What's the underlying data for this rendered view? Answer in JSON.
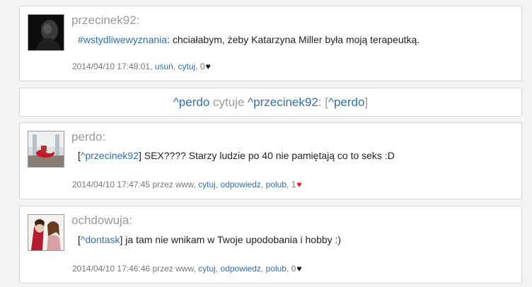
{
  "posts": [
    {
      "author": "przecinek92:",
      "hashtag": "#wstydliwewyznania",
      "text": ": chciałabym, żeby Katarzyna Miller była moją terapeutką.",
      "timestamp": "2014/04/10 17:48:01,",
      "actions": [
        "usuń",
        "cytuj"
      ],
      "likes": "0",
      "heart": "black"
    },
    {
      "author": "perdo:",
      "reply_to": "^przecinek92",
      "text": " SEX???? Starzy ludzie po 40 nie pamiętają co to seks :D",
      "timestamp": "2014/04/10 17:47:45",
      "via": "przez www,",
      "actions": [
        "cytuj",
        "odpowiedz",
        "polub"
      ],
      "likes": "1",
      "heart": "red"
    },
    {
      "author": "ochdowuja:",
      "reply_to": "^dontask",
      "text": " ja tam nie wnikam w Twoje upodobania i hobby :)",
      "timestamp": "2014/04/10 17:46:46",
      "via": "przez www,",
      "actions": [
        "cytuj",
        "odpowiedz",
        "polub"
      ],
      "likes": "0",
      "heart": "black"
    }
  ],
  "quote_bar": {
    "quoter": "^perdo",
    "verb": " cytuje ",
    "quoted": "^przecinek92",
    "sep": ": [",
    "inner": "^perdo",
    "close": "]"
  },
  "punct": {
    "comma": ",",
    "open_bracket": "[",
    "close_bracket": "]",
    "heart_glyph": "♥"
  },
  "colors": {
    "link": "#2f6fb0",
    "muted": "#9a9a9a",
    "heart_red": "#e0181e"
  }
}
